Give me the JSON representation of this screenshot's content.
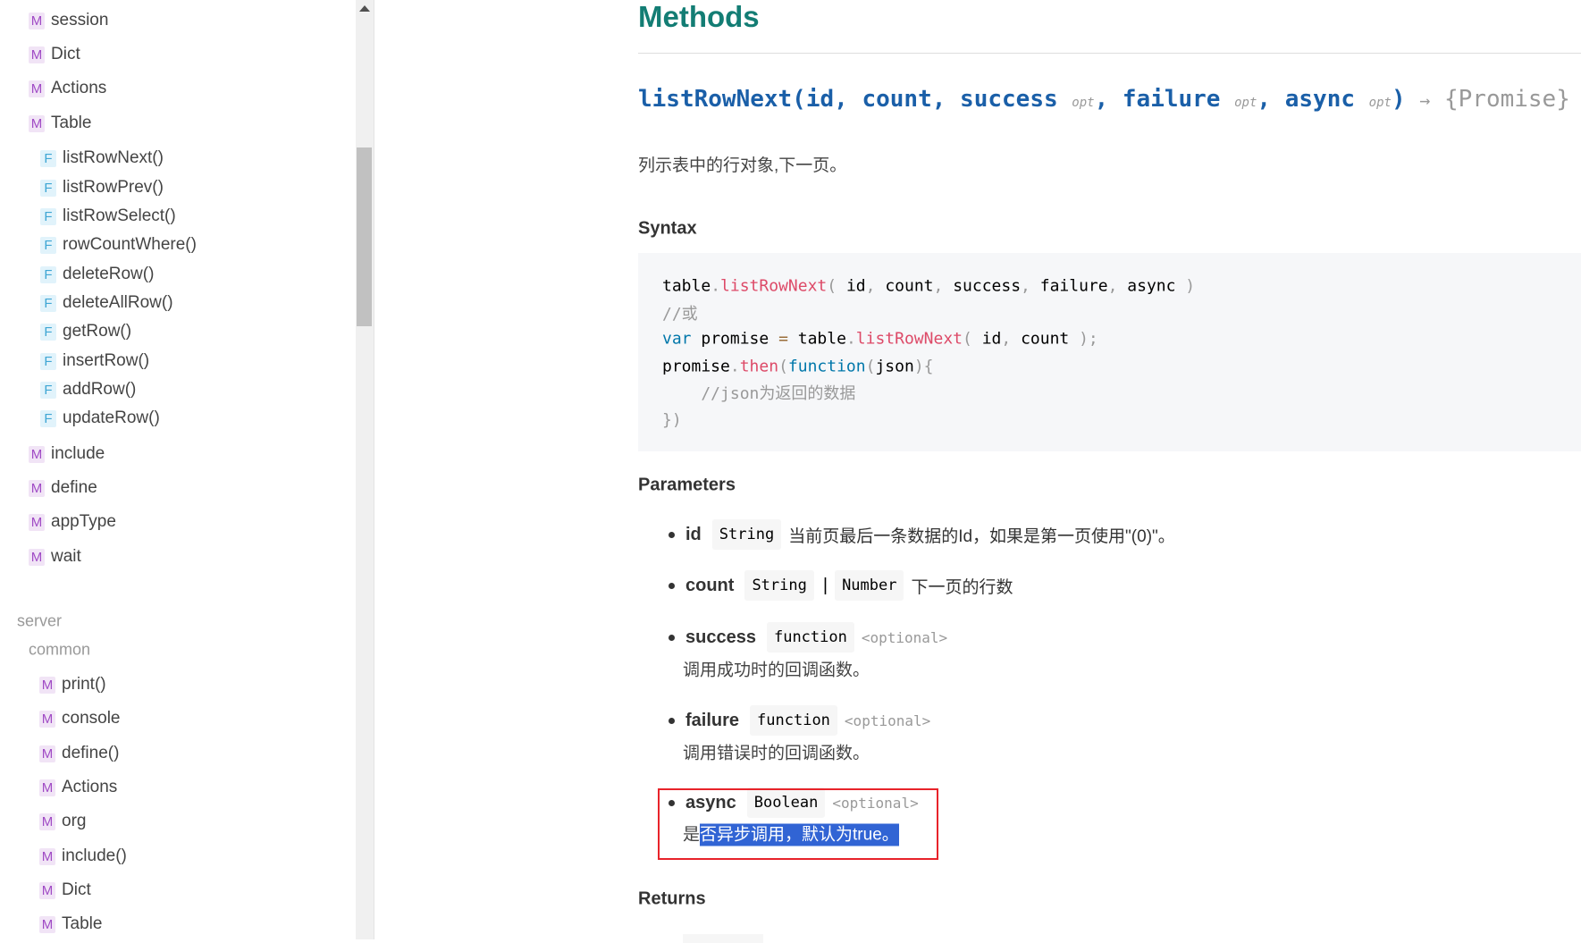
{
  "sidebar": {
    "top_items": [
      {
        "badge": "M",
        "label": "session"
      },
      {
        "badge": "M",
        "label": "Dict"
      },
      {
        "badge": "M",
        "label": "Actions"
      },
      {
        "badge": "M",
        "label": "Table"
      }
    ],
    "table_functions": [
      {
        "badge": "F",
        "label": "listRowNext()"
      },
      {
        "badge": "F",
        "label": "listRowPrev()"
      },
      {
        "badge": "F",
        "label": "listRowSelect()"
      },
      {
        "badge": "F",
        "label": "rowCountWhere()"
      },
      {
        "badge": "F",
        "label": "deleteRow()"
      },
      {
        "badge": "F",
        "label": "deleteAllRow()"
      },
      {
        "badge": "F",
        "label": "getRow()"
      },
      {
        "badge": "F",
        "label": "insertRow()"
      },
      {
        "badge": "F",
        "label": "addRow()"
      },
      {
        "badge": "F",
        "label": "updateRow()"
      }
    ],
    "more_items": [
      {
        "badge": "M",
        "label": "include"
      },
      {
        "badge": "M",
        "label": "define"
      },
      {
        "badge": "M",
        "label": "appType"
      },
      {
        "badge": "M",
        "label": "wait"
      }
    ],
    "group_server": "server",
    "group_common": "common",
    "common_items": [
      {
        "badge": "M",
        "label": "print()"
      },
      {
        "badge": "M",
        "label": "console"
      },
      {
        "badge": "M",
        "label": "define()"
      },
      {
        "badge": "M",
        "label": "Actions"
      },
      {
        "badge": "M",
        "label": "org"
      },
      {
        "badge": "M",
        "label": "include()"
      },
      {
        "badge": "M",
        "label": "Dict"
      },
      {
        "badge": "M",
        "label": "Table"
      }
    ]
  },
  "main": {
    "heading": "Methods",
    "signature": {
      "name": "listRowNext(",
      "p1": "id, ",
      "p2": "count, ",
      "p3": "success",
      "p4": "failure",
      "p5": "async",
      "opt": "opt",
      "comma": ", ",
      "close": ")",
      "arrow": "→",
      "returns": "{Promise}"
    },
    "description": "列示表中的行对象,下一页。",
    "syntax_heading": "Syntax",
    "code": {
      "l1": {
        "a": "table",
        "b": ".",
        "c": "listRowNext",
        "d": "( ",
        "e": "id",
        ",": ", ",
        "f": "count",
        "g": "success",
        "h": "failure",
        "i": "async",
        "j": " )"
      },
      "l2": "//或",
      "l3": {
        "kw": "var",
        "a": " promise ",
        "eq": "=",
        "b": " table",
        "c": "listRowNext",
        "d": "( ",
        "e": "id",
        "f": "count",
        "g": " );"
      },
      "l4": {
        "a": "promise",
        "c": "then",
        "kw": "function",
        "j": "json"
      },
      "l5": "    //json为返回的数据",
      "l6": "})"
    },
    "parameters_heading": "Parameters",
    "params": [
      {
        "name": "id",
        "types": [
          "String"
        ],
        "desc": "当前页最后一条数据的Id，如果是第一页使用\"(0)\"。"
      },
      {
        "name": "count",
        "types": [
          "String",
          "Number"
        ],
        "sep": "|",
        "desc": "下一页的行数"
      },
      {
        "name": "success",
        "types": [
          "function"
        ],
        "optional": "<optional>",
        "desc": "调用成功时的回调函数。"
      },
      {
        "name": "failure",
        "types": [
          "function"
        ],
        "optional": "<optional>",
        "desc": "调用错误时的回调函数。"
      },
      {
        "name": "async",
        "types": [
          "Boolean"
        ],
        "optional": "<optional>",
        "desc_plain": "是",
        "desc_selected": "否异步调用，默认为true。"
      }
    ],
    "returns_heading": "Returns"
  },
  "colors": {
    "heading": "#137d74",
    "signature": "#1a5fa8",
    "selection": "#3164d4",
    "highlight_box": "#e8232a"
  }
}
